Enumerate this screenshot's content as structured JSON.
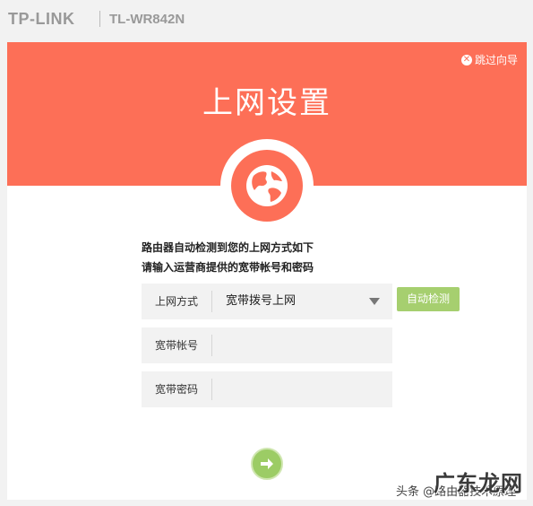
{
  "header": {
    "brand": "TP-LINK",
    "model": "TL-WR842N"
  },
  "hero": {
    "title": "上网设置",
    "skip_label": "跳过向导",
    "icon": "globe-icon",
    "color": "#fd6f57"
  },
  "prompt": {
    "line1": "路由器自动检测到您的上网方式如下",
    "line2": "请输入运营商提供的宽带帐号和密码"
  },
  "form": {
    "connection_type": {
      "label": "上网方式",
      "value": "宽带拨号上网"
    },
    "account": {
      "label": "宽带帐号",
      "value": ""
    },
    "password": {
      "label": "宽带密码",
      "value": ""
    },
    "auto_detect_label": "自动检测"
  },
  "next_icon": "arrow-right-icon",
  "colors": {
    "accent": "#fd6f57",
    "button_green": "#a6cf6f",
    "next_green": "#9ccc65"
  },
  "watermark": {
    "text": "头条 @路由器技术原理",
    "logo": "广东龙网"
  }
}
